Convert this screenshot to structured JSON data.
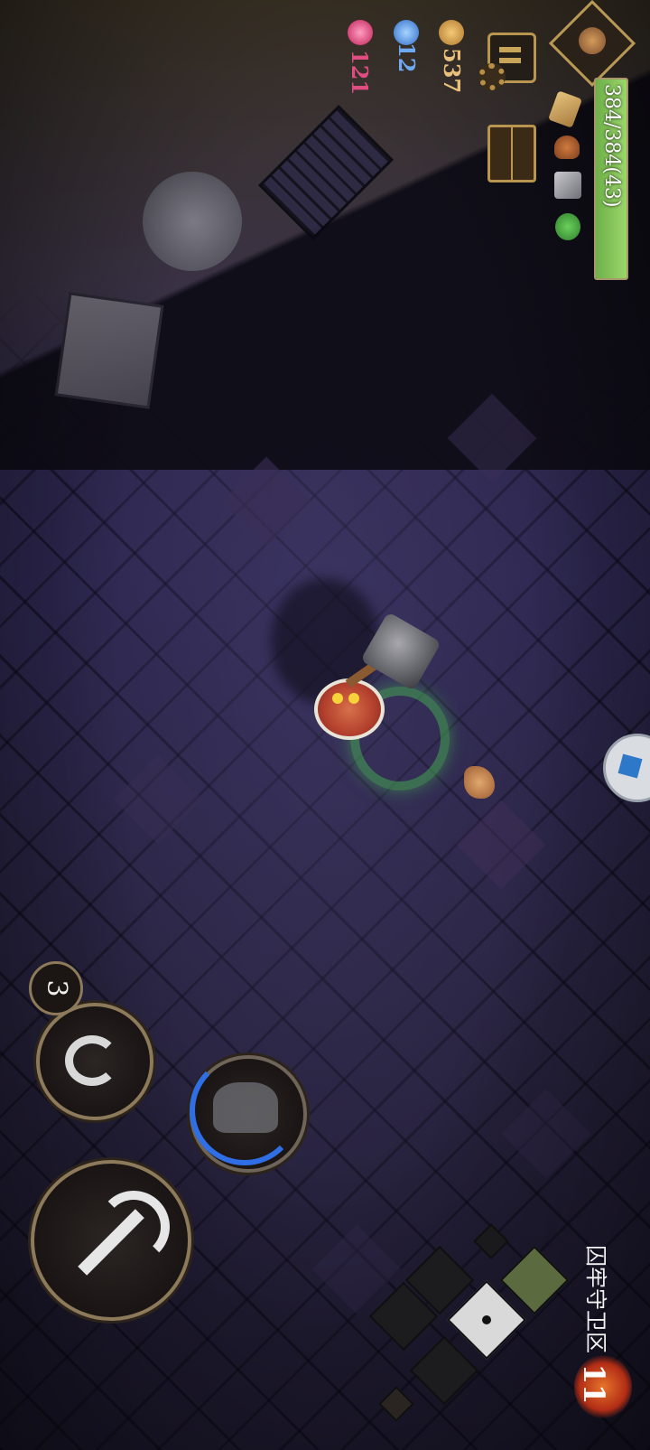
{
  "hud": {
    "hp_text": "384/384(43)",
    "hp_fraction": 1.0,
    "coins": "537",
    "blue_gems": "12",
    "red_gems": "121"
  },
  "actions": {
    "skill_charges": "3"
  },
  "minimap": {
    "area_name": "囚牢守卫区",
    "level": "11"
  },
  "colors": {
    "hp_green": "#7fc24f",
    "coin_gold": "#d8a54b",
    "blue_gem": "#4a8ee0",
    "red_gem": "#d53a6b"
  }
}
